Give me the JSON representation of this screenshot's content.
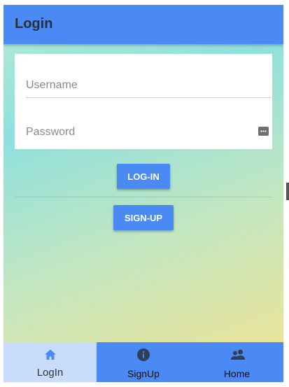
{
  "appbar": {
    "title": "Login"
  },
  "form": {
    "username": {
      "placeholder": "Username",
      "value": ""
    },
    "password": {
      "placeholder": "Password",
      "value": "",
      "toggle_icon": "password-dots-icon"
    }
  },
  "buttons": {
    "login": "LOG-IN",
    "signup": "SIGN-UP"
  },
  "bottom_nav": {
    "items": [
      {
        "label": "LogIn",
        "icon": "home-icon",
        "selected": true
      },
      {
        "label": "SignUp",
        "icon": "info-icon",
        "selected": false
      },
      {
        "label": "Home",
        "icon": "people-icon",
        "selected": false
      }
    ]
  },
  "colors": {
    "primary": "#4b89f5",
    "selected_tab": "#c9dcfb",
    "title_text": "#263238"
  }
}
